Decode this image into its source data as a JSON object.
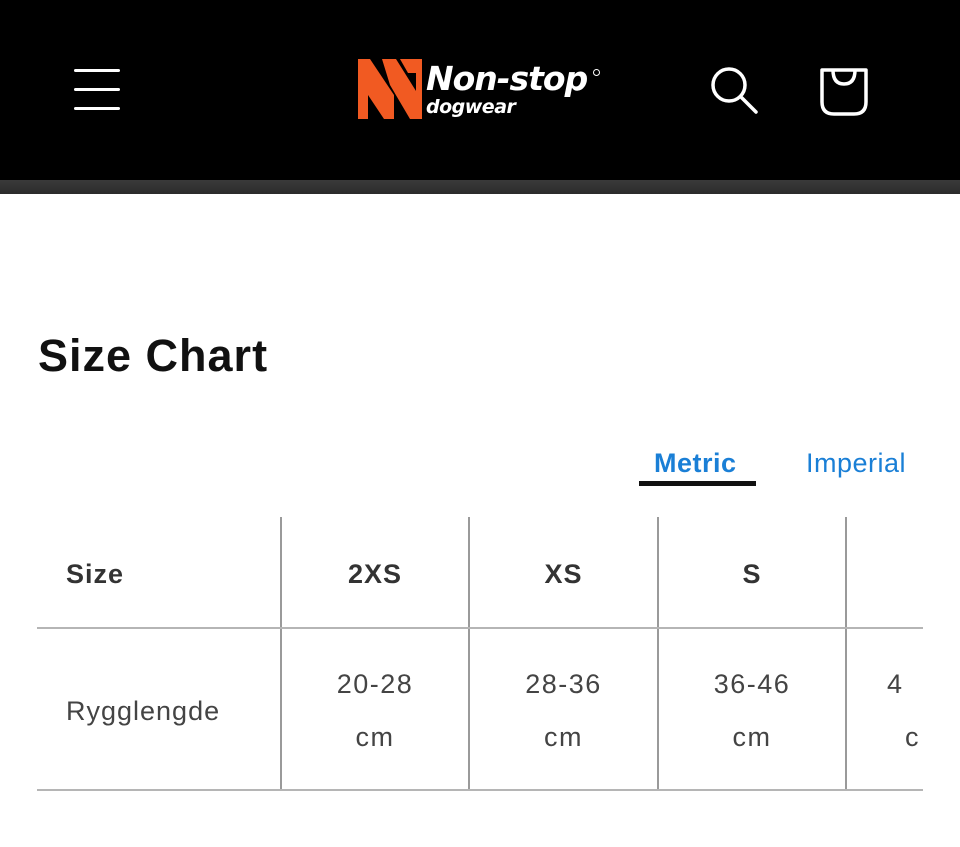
{
  "header": {
    "menu_icon": "hamburger-menu-icon",
    "brand": {
      "name": "Non-stop",
      "sub": "dogwear",
      "mark_color": "#f15a22"
    },
    "search_icon": "search-icon",
    "cart_icon": "shopping-bag-icon"
  },
  "page": {
    "title": "Size Chart"
  },
  "unit_tabs": {
    "metric": "Metric",
    "imperial": "Imperial",
    "active": "Metric",
    "accent_color": "#1a7fd6"
  },
  "size_table": {
    "columns": [
      "Size",
      "2XS",
      "XS",
      "S",
      ""
    ],
    "rows": [
      {
        "label": "Rygglengde",
        "values": [
          {
            "range": "20-28",
            "unit": "cm"
          },
          {
            "range": "28-36",
            "unit": "cm"
          },
          {
            "range": "36-46",
            "unit": "cm"
          },
          {
            "range": "4",
            "unit": "c"
          }
        ]
      }
    ]
  }
}
